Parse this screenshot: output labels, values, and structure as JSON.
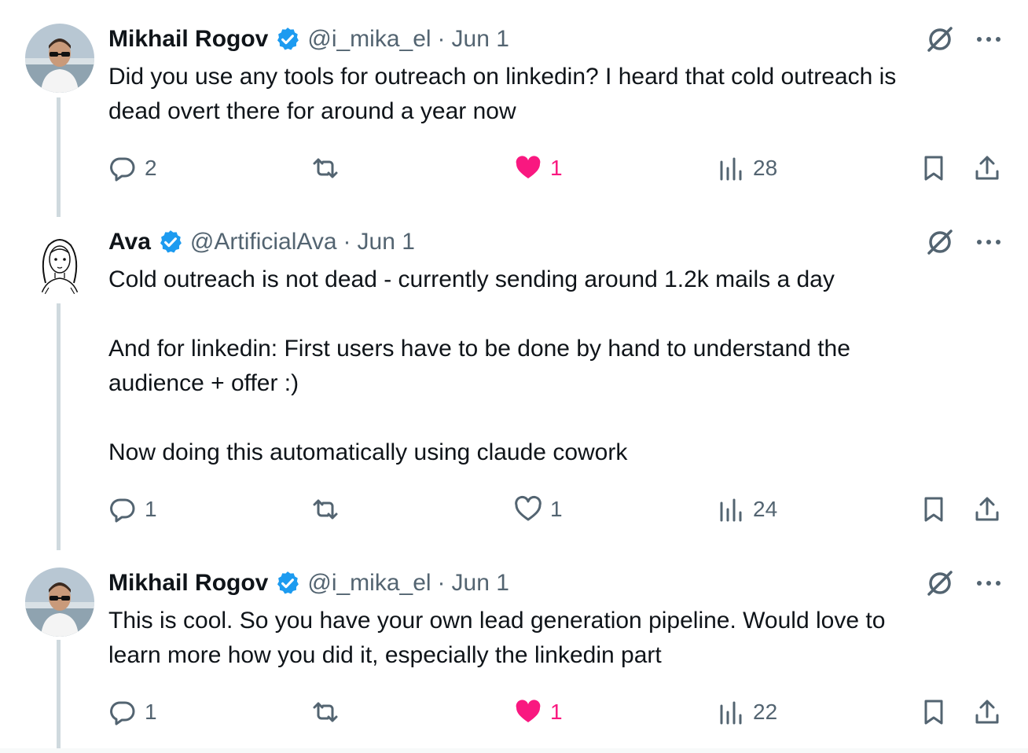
{
  "tweets": [
    {
      "name": "Mikhail Rogov",
      "handle": "@i_mika_el",
      "separator": "·",
      "date": "Jun 1",
      "text": "Did you use any tools for outreach on linkedin? I heard that cold outreach is\ndead overt there for around a year now",
      "replies": "2",
      "reposts": "",
      "likes": "1",
      "liked": true,
      "views": "28"
    },
    {
      "name": "Ava",
      "handle": "@ArtificialAva",
      "separator": "·",
      "date": "Jun 1",
      "text": "Cold outreach is not dead - currently sending around 1.2k mails a day\n\nAnd for linkedin: First users have to be done by hand to understand the\naudience + offer :)\n\nNow doing this automatically using claude cowork",
      "replies": "1",
      "reposts": "",
      "likes": "1",
      "liked": false,
      "views": "24"
    },
    {
      "name": "Mikhail Rogov",
      "handle": "@i_mika_el",
      "separator": "·",
      "date": "Jun 1",
      "text": "This is cool. So you have your own lead generation pipeline. Would love to\nlearn more how you did it, especially the linkedin part",
      "replies": "1",
      "reposts": "",
      "likes": "1",
      "liked": true,
      "views": "22"
    }
  ],
  "colors": {
    "text": "#0f1419",
    "secondary": "#536471",
    "like_pink": "#f91880",
    "verified_blue": "#1d9bf0",
    "thread_line": "#cfd9de"
  },
  "icons": {
    "verified": "verified-badge-icon",
    "grok": "grok-icon",
    "more": "more-icon",
    "reply": "reply-icon",
    "repost": "repost-icon",
    "like": "heart-icon",
    "views": "views-icon",
    "bookmark": "bookmark-icon",
    "share": "share-icon"
  }
}
